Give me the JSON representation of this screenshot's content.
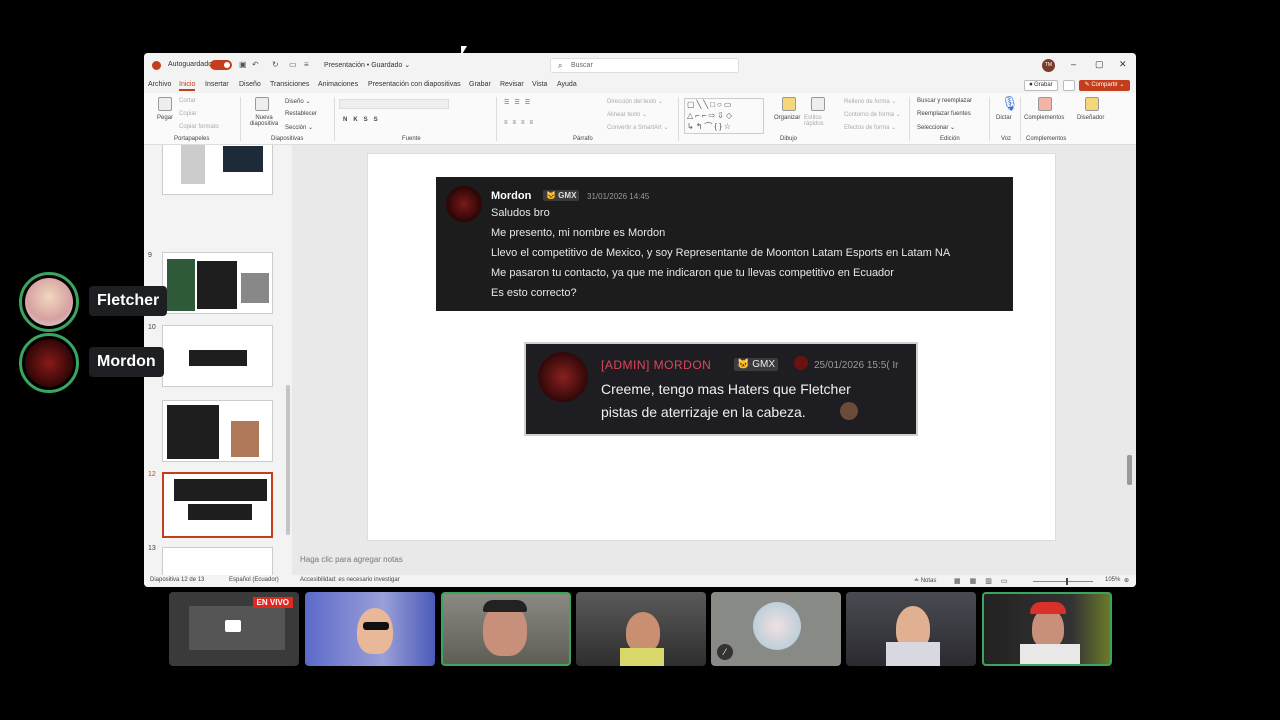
{
  "window": {
    "autosave_label": "Autoguardado",
    "doc_title": "Presentación • Guardado ⌄",
    "search_placeholder": "Buscar",
    "user_initials": "TM"
  },
  "tabs": [
    "Archivo",
    "Inicio",
    "Insertar",
    "Diseño",
    "Transiciones",
    "Animaciones",
    "Presentación con diapositivas",
    "Grabar",
    "Revisar",
    "Vista",
    "Ayuda"
  ],
  "active_tab": "Inicio",
  "header_buttons": {
    "record": "⏺ Grabar",
    "share": "✎ Compartir ⌄"
  },
  "ribbon": {
    "paste": "Pegar",
    "cut": "Cortar",
    "copy": "Copiar",
    "format_painter": "Copiar formato",
    "new_slide": "Nueva diapositiva",
    "layout": "Diseño ⌄",
    "reset": "Restablecer",
    "section": "Sección ⌄",
    "text_direction": "Dirección del texto ⌄",
    "align_text": "Alinear texto ⌄",
    "smartart": "Convertir a SmartArt ⌄",
    "arrange": "Organizar",
    "quick_styles": "Estilos rápidos",
    "shape_fill": "Relleno de forma ⌄",
    "shape_outline": "Contorno de forma ⌄",
    "shape_effects": "Efectos de forma ⌄",
    "find_replace": "Buscar y reemplazar",
    "replace_fonts": "Reemplazar fuentes",
    "select": "Seleccionar ⌄",
    "dictate": "Dictar",
    "addins": "Complementos",
    "designer": "Diseñador",
    "groups": [
      "Portapapeles",
      "Diapositivas",
      "Fuente",
      "Párrafo",
      "Dibujo",
      "Edición",
      "Voz",
      "Complementos"
    ]
  },
  "thumbnails": [
    {
      "num": "9"
    },
    {
      "num": "10"
    },
    {
      "num": ""
    },
    {
      "num": "12",
      "selected": true
    },
    {
      "num": "13"
    }
  ],
  "slide": {
    "msg1": {
      "author": "Mordon",
      "tag": "🐱 GMX",
      "timestamp": "31/01/2026 14:45",
      "lines": [
        "Saludos bro",
        "Me presento, mi nombre es Mordon",
        "Llevo el competitivo de Mexico, y soy Representante de Moonton Latam Esports en Latam NA",
        "Me pasaron tu contacto, ya que me indicaron que tu llevas competitivo en Ecuador",
        "Es esto correcto?"
      ]
    },
    "msg2": {
      "author": "[ADMIN] MORDON",
      "tag": "🐱 GMX",
      "timestamp": "25/01/2026 15:5( Ir",
      "lines": [
        "Creeme, tengo mas Haters que Fletcher",
        "pistas de aterrizaje en la cabeza."
      ]
    }
  },
  "notes_placeholder": "Haga clic para agregar notas",
  "status": {
    "slide_of": "Diapositiva 12 de 13",
    "language": "Español (Ecuador)",
    "accessibility": "Accesibilidad: es necesario investigar",
    "notes": "≐ Notas",
    "zoom": "105%"
  },
  "voice_users": [
    {
      "name": "Fletcher"
    },
    {
      "name": "Mordon"
    }
  ],
  "live_badge": "EN VIVO",
  "colors": {
    "accent": "#c43e1c",
    "speaking": "#3aa55d",
    "admin_name": "#e0445a"
  }
}
